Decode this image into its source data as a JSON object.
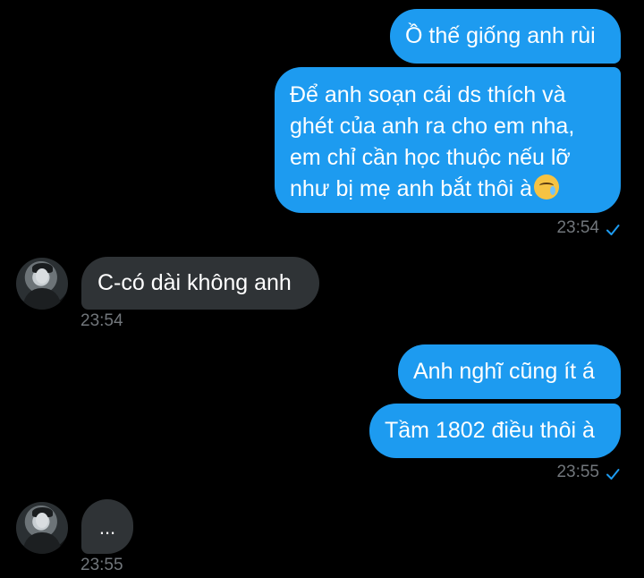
{
  "messages": [
    {
      "text": "Ồ thế giống anh rùi"
    },
    {
      "lines": [
        "Để anh soạn cái ds thích và",
        "ghét của anh ra cho em nha,",
        "em chỉ cần học thuộc nếu lỡ",
        "như bị mẹ anh bắt thôi à"
      ],
      "emoji": "crying-face"
    },
    {
      "text": "C-có dài không anh",
      "time": "23:54"
    },
    {
      "text": "Anh nghĩ cũng ít á"
    },
    {
      "text": "Tầm 1802 điều thôi à"
    },
    {
      "text": "...",
      "time": "23:55"
    }
  ],
  "outgoing_times": [
    "23:54",
    "23:55"
  ],
  "colors": {
    "outgoing_bubble": "#1d9bf0",
    "incoming_bubble": "#2f3336",
    "background": "#000000",
    "timestamp": "#71767b"
  }
}
